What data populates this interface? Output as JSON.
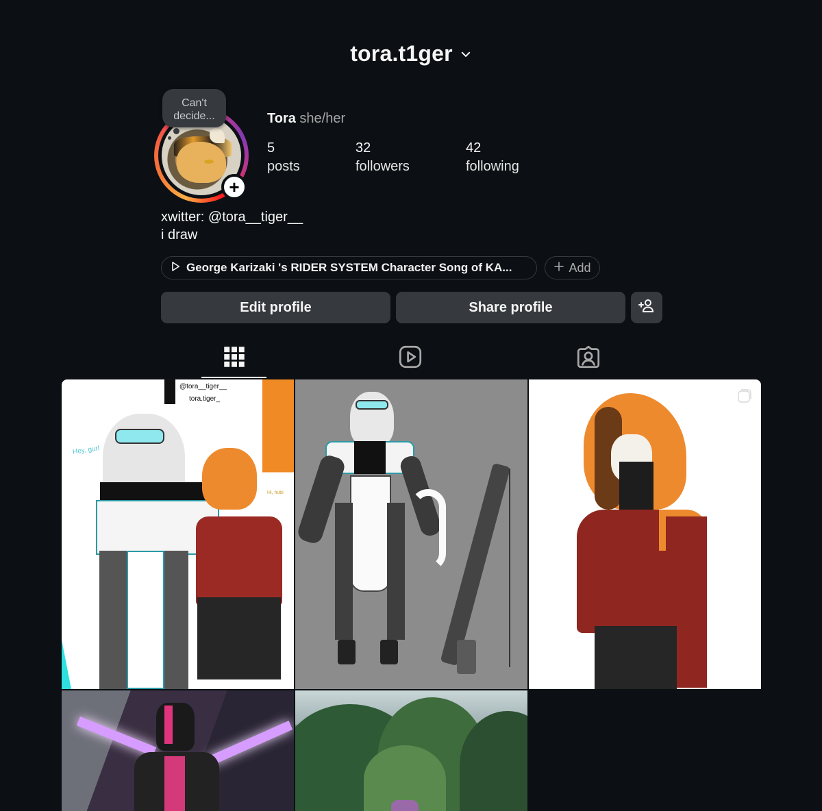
{
  "header": {
    "username": "tora.t1ger"
  },
  "profile": {
    "note": "Can't decide...",
    "name": "Tora",
    "pronouns": "she/her",
    "stats": [
      {
        "value": "5",
        "label": "posts"
      },
      {
        "value": "32",
        "label": "followers"
      },
      {
        "value": "42",
        "label": "following"
      }
    ],
    "bio_line1": "xwitter: @tora__tiger__",
    "bio_line2": "i draw",
    "music": "George Karizaki 's RIDER SYSTEM Character Song of KA...",
    "add_label": "Add"
  },
  "actions": {
    "edit_label": "Edit profile",
    "share_label": "Share profile"
  },
  "tabs": [
    "posts-grid",
    "reels",
    "tagged"
  ],
  "posts": {
    "p1_handle_x": "@tora__tiger__",
    "p1_handle_discord": "tora.tiger_",
    "p1_greeting": "Hey, gurl",
    "p1_reply": "Hi, hubi"
  },
  "colors": {
    "background": "#0c1014",
    "button": "#363a3f",
    "secondary_text": "#a8a8a8"
  }
}
